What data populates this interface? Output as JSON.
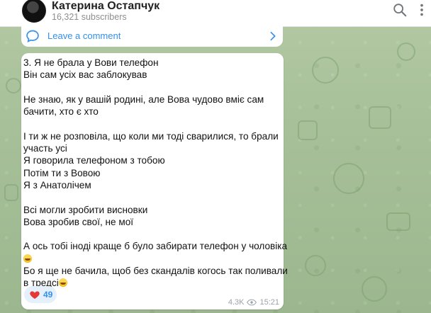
{
  "channel": {
    "name": "Катерина Остапчук",
    "subscribers": "16,321 subscribers"
  },
  "header": {
    "search_icon": "search-icon",
    "more_icon": "more-vertical-icon"
  },
  "comments": {
    "label": "Leave a comment",
    "icon": "speech-bubble-icon"
  },
  "message": {
    "lines": [
      "3. Я не брала у Вови телефон",
      "Він сам усіх вас заблокував",
      "",
      "Не знаю, як у вашій родині, але Вова чудово вміє сам",
      "бачити, хто є хто",
      "",
      "І ти ж не розповіла, що коли ми тоді сварилися, то брали",
      "участь усі",
      "Я говорила телефоном з тобою",
      "Потім ти з Вовою",
      "Я з Анатолічем",
      "",
      "Всі могли зробити висновки",
      "Вова зробив свої, не мої",
      "",
      "А ось тобі іноді краще б було забирати телефон у чоловіка",
      "",
      "Бо я ще не бачила, щоб без скандалів когось так поливали",
      "в тредсі"
    ],
    "reaction": {
      "emoji": "heart-icon",
      "count": "49"
    },
    "views": "4.3K",
    "time": "15:21"
  },
  "colors": {
    "accent": "#3390ec",
    "heart": "#e53935",
    "wallpaper": "#a9c19a"
  }
}
